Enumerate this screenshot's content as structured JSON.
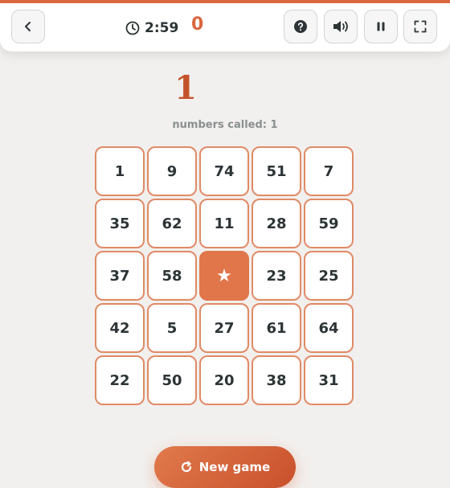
{
  "header": {
    "timer": "2:59",
    "score": "0",
    "icons": [
      "back-icon",
      "clock-icon",
      "help-icon",
      "sound-icon",
      "pause-icon",
      "fullscreen-icon"
    ]
  },
  "game": {
    "last_called": "1",
    "called_label": "numbers called: ",
    "called_count": "1",
    "board": [
      [
        "1",
        "9",
        "74",
        "51",
        "7"
      ],
      [
        "35",
        "62",
        "11",
        "28",
        "59"
      ],
      [
        "37",
        "58",
        "★",
        "23",
        "25"
      ],
      [
        "42",
        "5",
        "27",
        "61",
        "64"
      ],
      [
        "22",
        "50",
        "20",
        "38",
        "31"
      ]
    ],
    "free_cell_symbol": "★"
  },
  "actions": {
    "new_game_label": "New game"
  },
  "colors": {
    "accent": "#d9673f",
    "free_cell": "#e0764a",
    "cell_border": "#e08a66",
    "background": "#f2f0ee"
  }
}
